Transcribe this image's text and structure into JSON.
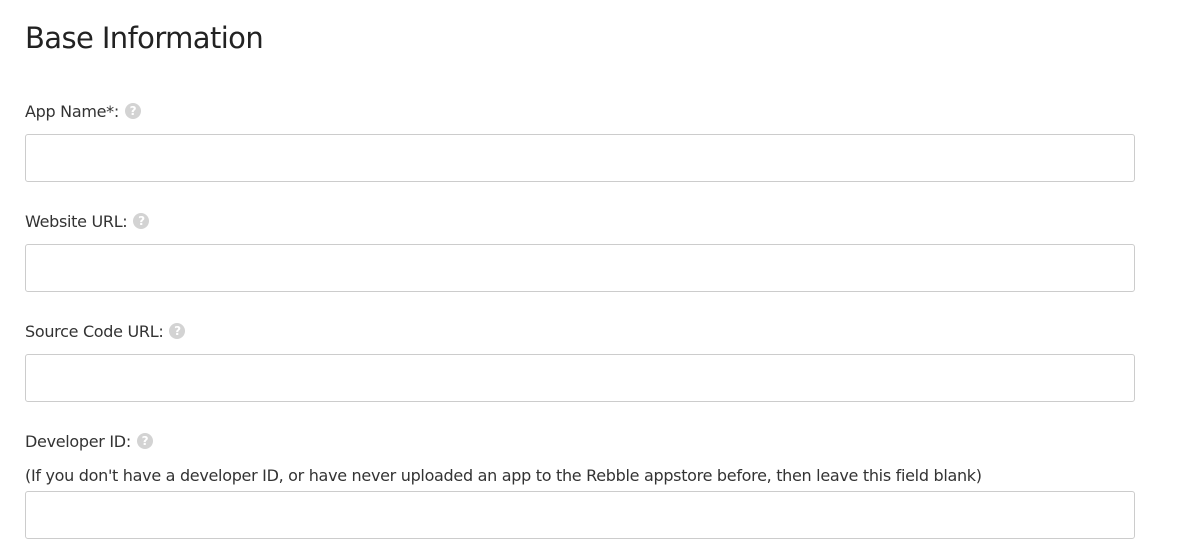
{
  "section": {
    "title": "Base Information",
    "help_glyph": "?"
  },
  "fields": {
    "app_name": {
      "label": "App Name*:",
      "value": "",
      "icon": "help-icon"
    },
    "website_url": {
      "label": "Website URL:",
      "value": "",
      "icon": "help-icon"
    },
    "source_code_url": {
      "label": "Source Code URL:",
      "value": "",
      "icon": "help-icon"
    },
    "developer_id": {
      "label": "Developer ID:",
      "value": "",
      "icon": "help-icon",
      "hint": "(If you don't have a developer ID, or have never uploaded an app to the Rebble appstore before, then leave this field blank)"
    }
  },
  "colors": {
    "help_icon": "#d3d3d3",
    "input_border": "#cccccc",
    "text": "#333333"
  }
}
